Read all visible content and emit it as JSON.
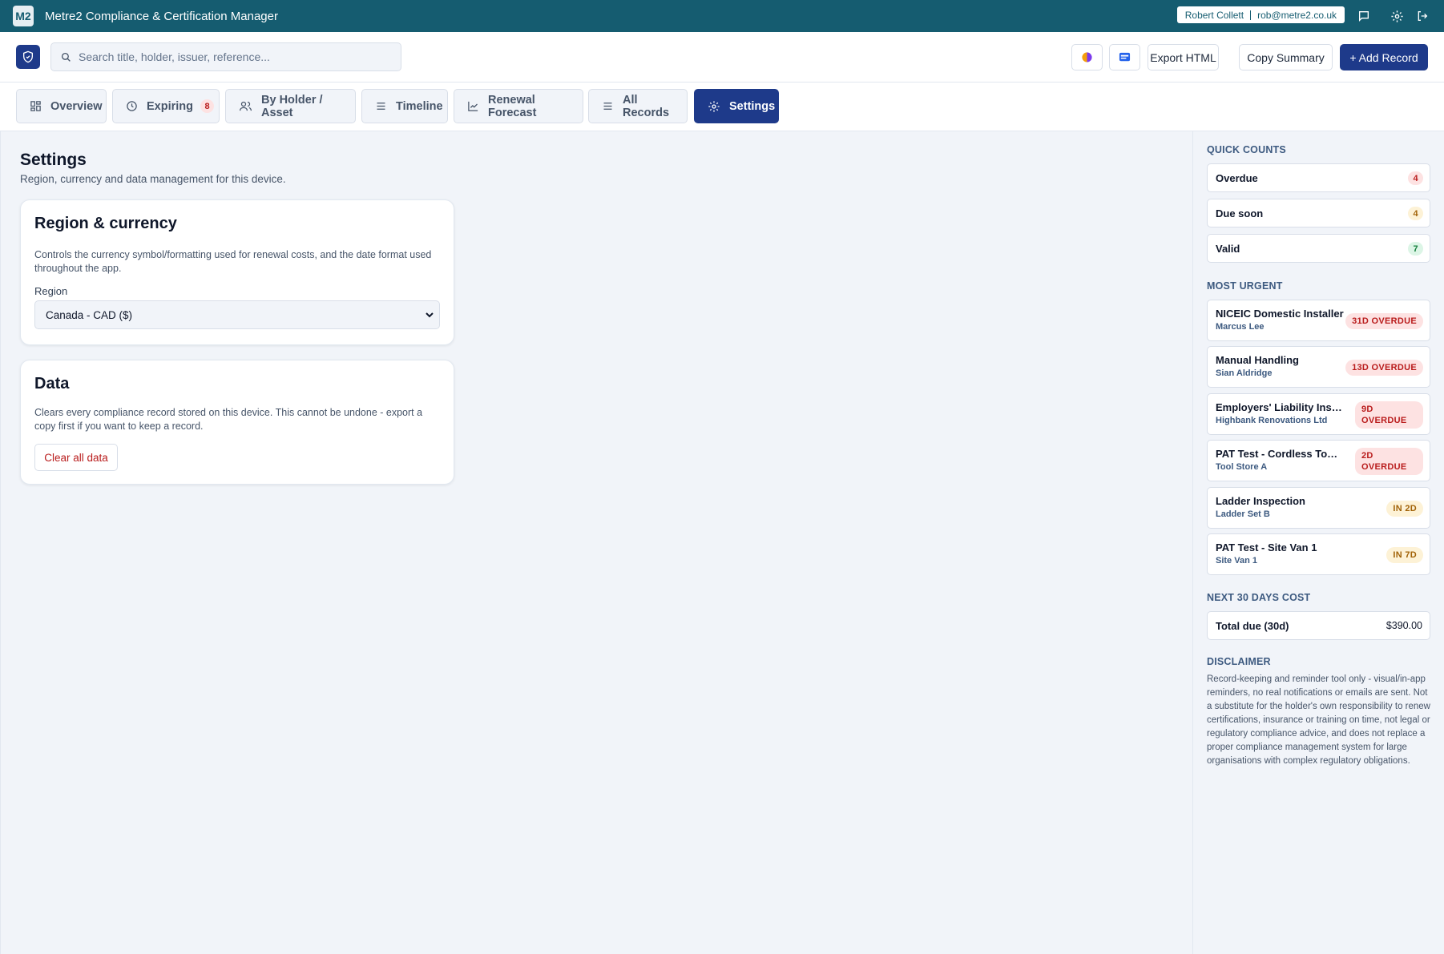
{
  "app": {
    "logo": "M2",
    "title": "Metre2 Compliance & Certification Manager"
  },
  "user": {
    "name": "Robert Collett",
    "email": "rob@metre2.co.uk"
  },
  "header_icons": [
    "chat-icon",
    "gear-icon",
    "logout-icon"
  ],
  "search": {
    "placeholder": "Search title, holder, issuer, reference..."
  },
  "toolbar": {
    "theme_icon": "palette-icon",
    "display_icon": "screen-icon",
    "export_label": "Export HTML",
    "copy_label": "Copy Summary",
    "add_label": "+ Add Record"
  },
  "tabs": [
    {
      "label": "Overview",
      "icon": "grid-icon"
    },
    {
      "label": "Expiring",
      "icon": "clock-icon",
      "badge": "8"
    },
    {
      "label": "By Holder / Asset",
      "icon": "users-icon"
    },
    {
      "label": "Timeline",
      "icon": "list-icon"
    },
    {
      "label": "Renewal Forecast",
      "icon": "chart-line-icon"
    },
    {
      "label": "All Records",
      "icon": "list-icon"
    },
    {
      "label": "Settings",
      "icon": "gear-icon",
      "active": true
    }
  ],
  "main": {
    "title": "Settings",
    "subtitle": "Region, currency and data management for this device.",
    "region_card": {
      "title": "Region & currency",
      "description": "Controls the currency symbol/formatting used for renewal costs, and the date format used throughout the app.",
      "field_label": "Region",
      "selected": "Canada - CAD ($)"
    },
    "data_card": {
      "title": "Data",
      "description": "Clears every compliance record stored on this device. This cannot be undone - export a copy first if you want to keep a record.",
      "button": "Clear all data"
    }
  },
  "sidebar": {
    "quick_counts_title": "QUICK COUNTS",
    "counts": [
      {
        "label": "Overdue",
        "value": "4",
        "tone": "red"
      },
      {
        "label": "Due soon",
        "value": "4",
        "tone": "amber"
      },
      {
        "label": "Valid",
        "value": "7",
        "tone": "green"
      }
    ],
    "most_urgent_title": "MOST URGENT",
    "urgent": [
      {
        "title": "NICEIC Domestic Installer",
        "holder": "Marcus Lee",
        "status": "31D OVERDUE",
        "tone": "red"
      },
      {
        "title": "Manual Handling",
        "holder": "Sian Aldridge",
        "status": "13D OVERDUE",
        "tone": "red"
      },
      {
        "title": "Employers' Liability Insurance",
        "holder": "Highbank Renovations Ltd",
        "status": "9D OVERDUE",
        "tone": "red"
      },
      {
        "title": "PAT Test - Cordless Tool Store",
        "holder": "Tool Store A",
        "status": "2D OVERDUE",
        "tone": "red"
      },
      {
        "title": "Ladder Inspection",
        "holder": "Ladder Set B",
        "status": "IN 2D",
        "tone": "amber"
      },
      {
        "title": "PAT Test - Site Van 1",
        "holder": "Site Van 1",
        "status": "IN 7D",
        "tone": "amber"
      }
    ],
    "cost_title": "NEXT 30 DAYS COST",
    "cost_label": "Total due (30d)",
    "cost_value": "$390.00",
    "disclaimer_title": "DISCLAIMER",
    "disclaimer_text": "Record-keeping and reminder tool only - visual/in-app reminders, no real notifications or emails are sent. Not a substitute for the holder's own responsibility to renew certifications, insurance or training on time, not legal or regulatory compliance advice, and does not replace a proper compliance management system for large organisations with complex regulatory obligations."
  },
  "colors": {
    "titlebar": "#155c70",
    "primary": "#1e3a8a",
    "danger": "#b91c1c",
    "warning": "#a16207",
    "success": "#15803d"
  }
}
